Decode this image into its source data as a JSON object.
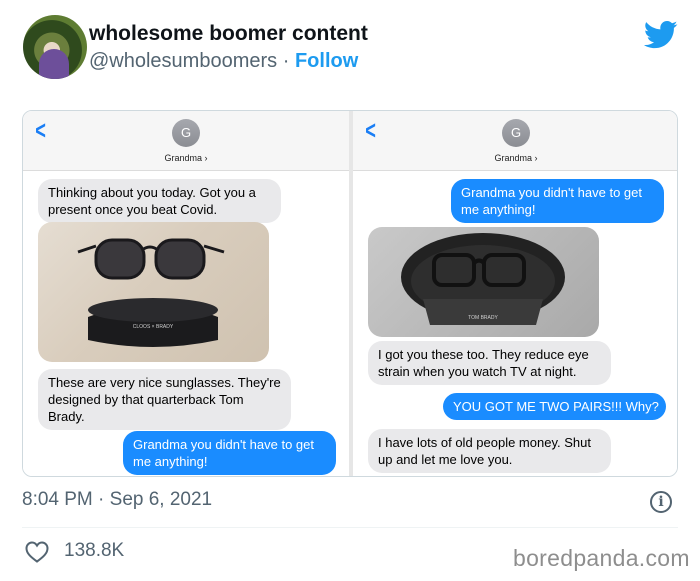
{
  "tweet": {
    "display_name": "wholesome boomer content",
    "handle": "@wholesumboomers",
    "separator": "·",
    "follow_label": "Follow",
    "timestamp": "8:04 PM · Sep 6, 2021",
    "like_count": "138.8K"
  },
  "screenshots": {
    "left": {
      "contact_initial": "G",
      "contact_name": "Grandma ›",
      "messages": [
        "Thinking about you today. Got you a present once you beat Covid.",
        "These are very nice sunglasses. They're designed by that quarterback Tom Brady.",
        "Grandma you didn't have to get me anything!"
      ],
      "case_text": "CLOOS × BRADY"
    },
    "right": {
      "contact_initial": "G",
      "contact_name": "Grandma ›",
      "messages": [
        "Grandma you didn't have to get me anything!",
        "I got you these too. They reduce eye strain when you watch TV at night.",
        "YOU GOT ME TWO PAIRS!!! Why?",
        "I have lots of old people money. Shut up and let me love you."
      ],
      "case_text": "TOM BRADY"
    }
  },
  "watermark": "boredpanda.com",
  "colors": {
    "twitter_blue": "#1d9bf0",
    "imessage_blue": "#1a8cff",
    "incoming_gray": "#e9e9eb",
    "secondary_text": "#536471"
  },
  "icons": [
    "twitter-logo-icon",
    "back-chevron-icon",
    "info-icon",
    "heart-icon"
  ]
}
